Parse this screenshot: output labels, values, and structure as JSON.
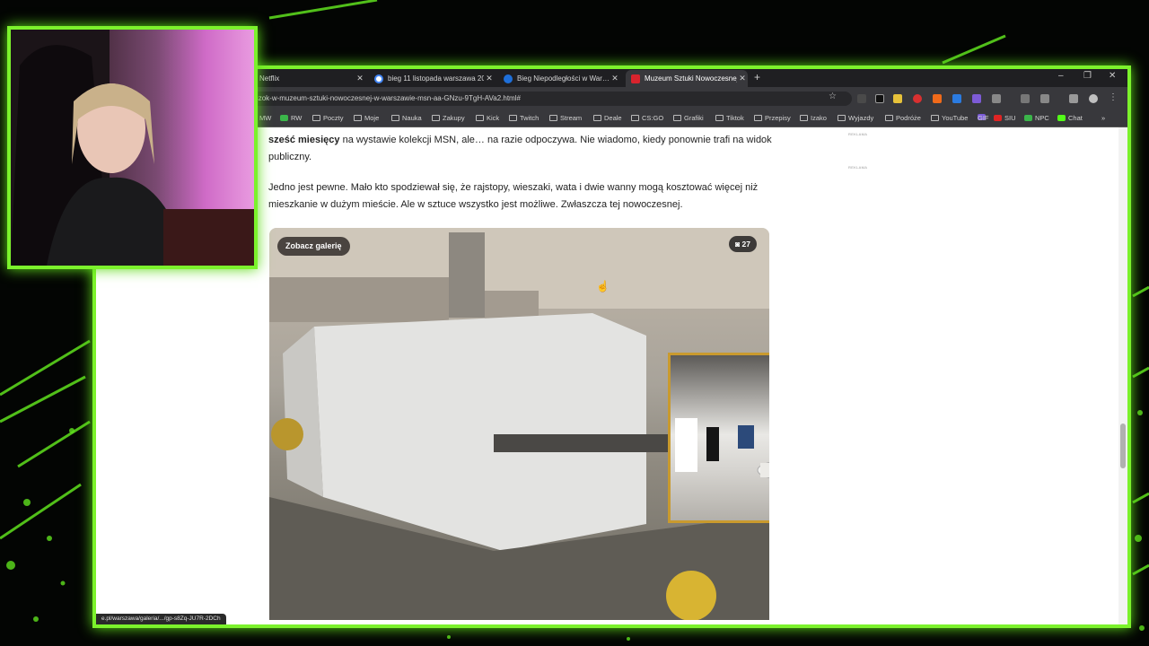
{
  "browser": {
    "tabs": [
      {
        "title": "Netflix",
        "active": false
      },
      {
        "title": "bieg 11 listopada warszawa 20…",
        "active": false
      },
      {
        "title": "Bieg Niepodległości w War…",
        "active": false
      },
      {
        "title": "Muzeum Sztuki Nowoczesnej w…",
        "active": true
      }
    ],
    "url": "re-wanny-i-rozciagniete-rajtki-za-prawie-milion-zl-szok-w-muzeum-sztuki-nowoczesnej-w-warszawie-msn-aa-GNzu-9TgH-AVa2.html#",
    "bookmarks": [
      "MW",
      "RW",
      "Poczty",
      "Moje",
      "Nauka",
      "Zakupy",
      "Kick",
      "Twitch",
      "Stream",
      "Deale",
      "CS:GO",
      "Grafiki",
      "Tiktok",
      "Przepisy",
      "Izako",
      "Wyjazdy",
      "Podróże",
      "YouTube",
      "GIF",
      "SIU",
      "NPC",
      "Chat"
    ]
  },
  "article": {
    "para1_bold": "sześć miesięcy",
    "para1_rest": " na wystawie kolekcji MSN, ale… na razie odpoczywa. Nie wiadomo, kiedy ponownie trafi na widok publiczny.",
    "para2": "Jedno jest pewne. Mało kto spodziewał się, że rajstopy, wieszaki, wata i dwie wanny mogą kosztować więcej niż mieszkanie w dużym mieście. Ale w sztuce wszystko jest możliwe. Zwłaszcza tej nowoczesnej.",
    "ad_label": "REKLAMA",
    "gallery_button": "Zobacz galerię",
    "photo_count": "27"
  },
  "status_url": "e.pl/warszawa/galeria/.../gp-s8Zq-JU7R-2DCh",
  "colors": {
    "frame_green": "#7cf22c",
    "pip_border": "#c99a2e"
  }
}
